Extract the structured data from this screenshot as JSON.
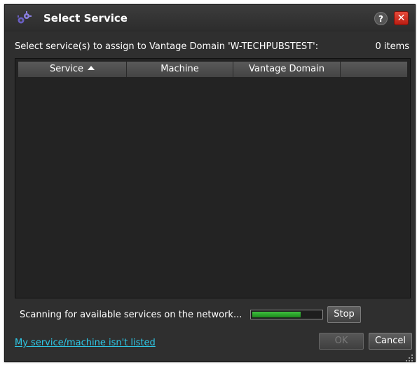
{
  "dialog": {
    "title": "Select Service",
    "help_label": "?",
    "close_label": "✕"
  },
  "prompt": {
    "text": "Select service(s) to assign to Vantage Domain 'W-TECHPUBSTEST':",
    "count": "0 items"
  },
  "table": {
    "columns": [
      "Service",
      "Machine",
      "Vantage Domain",
      ""
    ],
    "sort_column": "Service",
    "sort_direction": "ascending",
    "rows": []
  },
  "scan": {
    "status": "Scanning for available services on the network...",
    "progress": 0.7,
    "stop_label": "Stop"
  },
  "footer": {
    "link": "My service/machine isn't listed",
    "ok_label": "OK",
    "ok_enabled": false,
    "cancel_label": "Cancel"
  },
  "colors": {
    "background": "#2f2f2f",
    "link": "#2ec9e8",
    "progress_fill": "#2ea82e",
    "close_button": "#d0321f"
  },
  "icons": [
    "app-gear-icon",
    "help-icon",
    "close-icon",
    "sort-ascending-icon",
    "resize-grip-icon"
  ]
}
